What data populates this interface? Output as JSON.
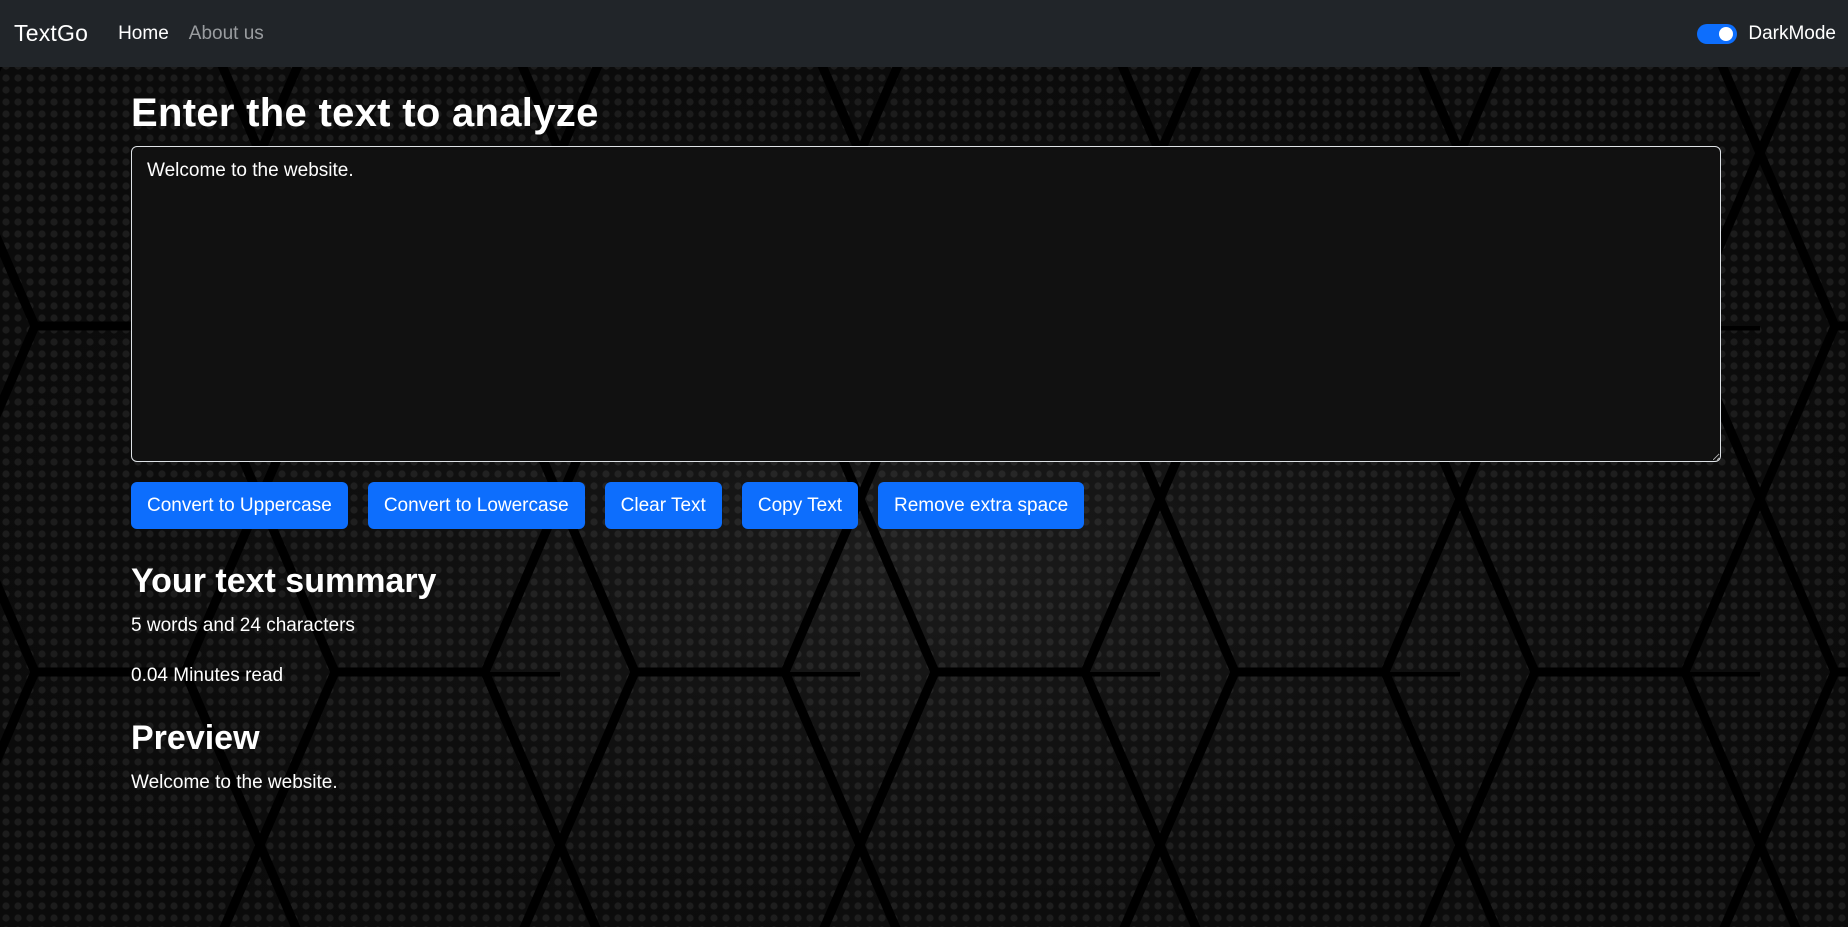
{
  "navbar": {
    "brand": "TextGo",
    "links": [
      {
        "label": "Home",
        "active": true
      },
      {
        "label": "About us",
        "active": false
      }
    ],
    "dark_mode_label": "DarkMode",
    "dark_mode_on": true
  },
  "main": {
    "heading": "Enter the text to analyze",
    "textarea_value": "Welcome to the website.",
    "buttons": [
      {
        "label": "Convert to Uppercase"
      },
      {
        "label": "Convert to Lowercase"
      },
      {
        "label": "Clear Text"
      },
      {
        "label": "Copy Text"
      },
      {
        "label": "Remove extra space"
      }
    ],
    "summary_heading": "Your text summary",
    "summary_counts": "5 words and 24 characters",
    "read_time": "0.04 Minutes read",
    "preview_heading": "Preview",
    "preview_text": "Welcome to the website."
  },
  "colors": {
    "navbar_bg": "#212529",
    "primary": "#0d6efd",
    "page_bg": "#050505",
    "textarea_bg": "#111111"
  }
}
